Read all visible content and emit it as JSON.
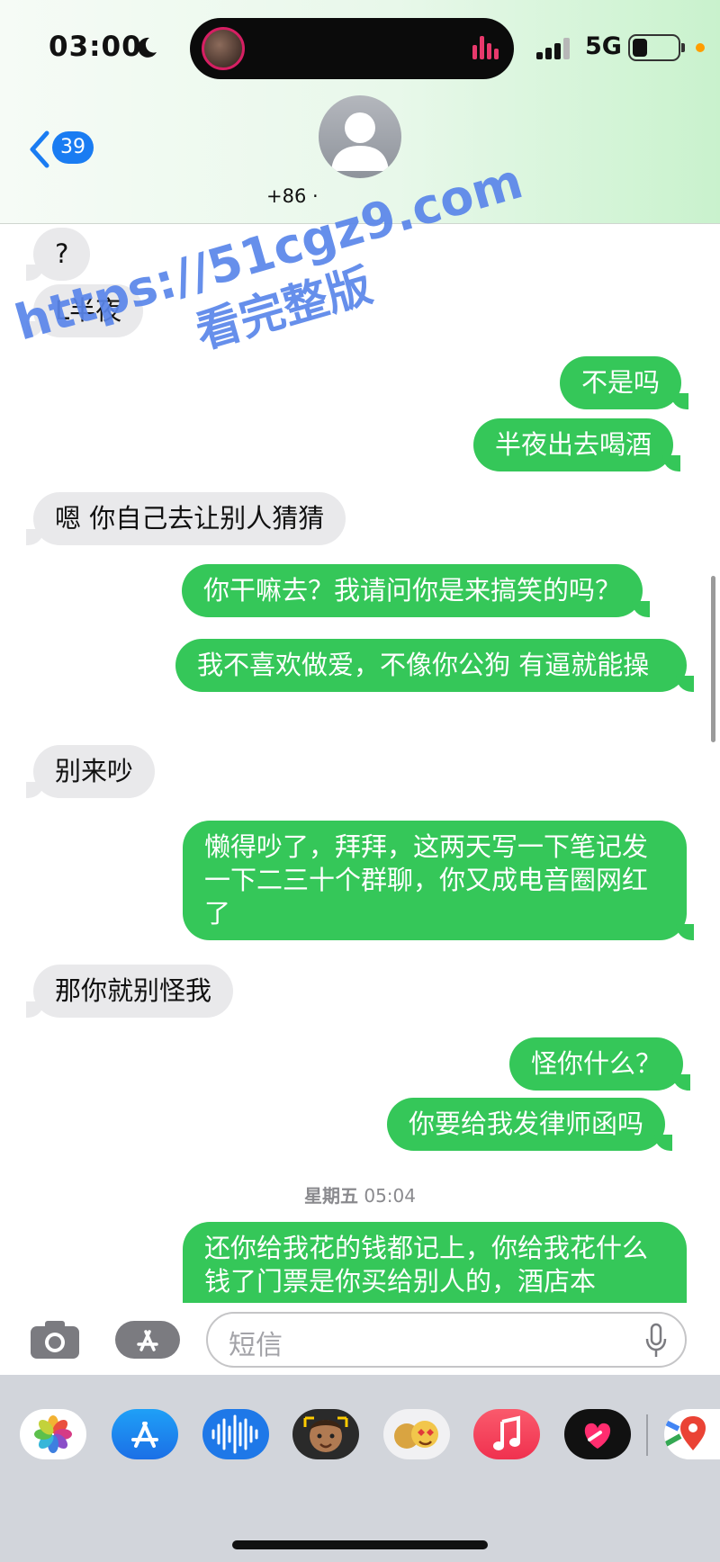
{
  "status_bar": {
    "time": "03:00",
    "network": "5G"
  },
  "header": {
    "back_count": "39",
    "phone": "+86 ·"
  },
  "messages": [
    {
      "dir": "in",
      "text": "?"
    },
    {
      "dir": "in",
      "text": "L半夜"
    },
    {
      "dir": "out",
      "text": "不是吗"
    },
    {
      "dir": "out",
      "text": "半夜出去喝酒"
    },
    {
      "dir": "in",
      "text": "嗯 你自己去让别人猜猜"
    },
    {
      "dir": "out",
      "text": "你干嘛去？我请问你是来搞笑的吗？"
    },
    {
      "dir": "out",
      "text": "我不喜欢做爱，不像你公狗 有逼就能操"
    },
    {
      "dir": "in",
      "text": "别来吵"
    },
    {
      "dir": "out",
      "text": "懒得吵了，拜拜，这两天写一下笔记发一下二三十个群聊，你又成电音圈网红了"
    },
    {
      "dir": "in",
      "text": "那你就别怪我"
    },
    {
      "dir": "out",
      "text": "怪你什么？"
    },
    {
      "dir": "out",
      "text": "你要给我发律师函吗"
    },
    {
      "dir": "out",
      "text": "还你给我花的钱都记上，你给我花什么钱了门票是你买给别人的，酒店本"
    }
  ],
  "timestamp": {
    "day": "星期五",
    "time": "05:04"
  },
  "watermark": {
    "line1": "https://51cgz9.com",
    "line2": "看完整版"
  },
  "composer": {
    "placeholder": "短信"
  },
  "apps": [
    "photos-app",
    "app-store-app",
    "voice-memos-app",
    "memoji-app",
    "animoji-stickers-app",
    "music-app",
    "fitness-app",
    "maps-app"
  ],
  "colors": {
    "outgoing": "#35c759",
    "incoming": "#e9e9eb",
    "badge": "#1a7cf2"
  }
}
